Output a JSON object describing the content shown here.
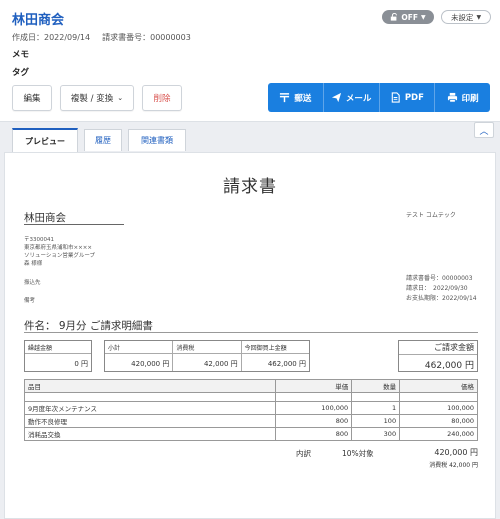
{
  "header": {
    "title": "林田商会",
    "created": "作成日：2022/09/14",
    "invoice_no": "請求書番号：00000003",
    "memo_label": "メモ",
    "tag_label": "タグ",
    "toggle_label": "OFF",
    "status_label": "未設定"
  },
  "toolbar": {
    "edit": "編集",
    "copy": "複製 / 変換",
    "delete": "削除",
    "mail_post": "郵送",
    "email": "メール",
    "pdf": "PDF",
    "print": "印刷"
  },
  "tabs": {
    "preview": "プレビュー",
    "history": "履歴",
    "related": "関連書類"
  },
  "doc": {
    "title": "請求書",
    "recipient": "林田商会",
    "postal": "〒3300041",
    "address": "東京都府玉県浦和市××××",
    "dept": "ソリューション営業グループ",
    "person": "森 様様",
    "bank_label": "振込先",
    "note_label": "備考",
    "sender": "テスト コムテック",
    "invoice_no": "請求書番号：00000003",
    "invoice_date": "請求日：　2022/09/30",
    "due_date": "お支払期限：2022/09/14",
    "subject": "件名：  9月分 ご請求明細書",
    "carry_label": "繰越金額",
    "carry_value": "0 円",
    "subtotal_label": "小計",
    "subtotal_value": "420,000 円",
    "tax_label": "消費税",
    "tax_value": "42,000 円",
    "current_label": "今回御買上金額",
    "current_value": "462,000 円",
    "total_label": "ご請求金額",
    "total_value": "462,000 円",
    "table_headers": [
      "品目",
      "単価",
      "数量",
      "価格"
    ],
    "items": [
      [
        "9月度年次メンテナンス",
        "100,000",
        "1",
        "100,000"
      ],
      [
        "動作不良修理",
        "800",
        "100",
        "80,000"
      ],
      [
        "消耗品交換",
        "800",
        "300",
        "240,000"
      ]
    ],
    "breakdown_label": "内訳",
    "breakdown_rate": "10%対象",
    "breakdown_amount": "420,000 円",
    "breakdown_tax": "消費税 42,000 円"
  },
  "colors": {
    "accent": "#1a7fe0",
    "title": "#1f5fbf",
    "danger": "#d9534f"
  }
}
